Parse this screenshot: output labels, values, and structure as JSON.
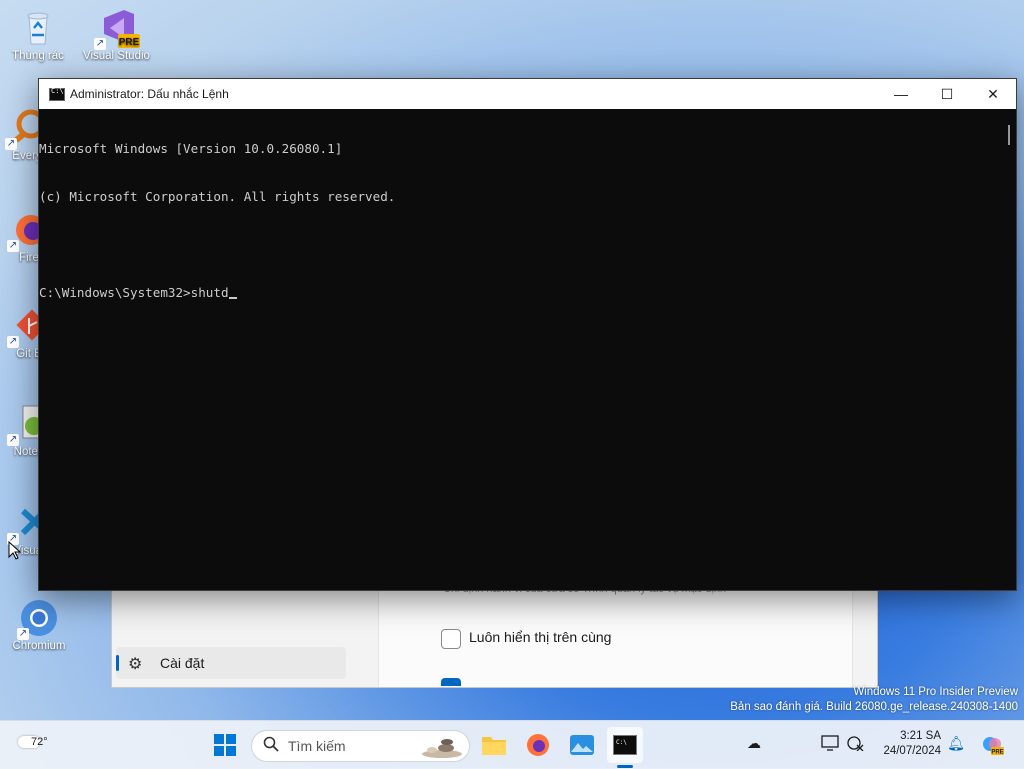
{
  "desktop": {
    "icons": [
      {
        "label": "Thùng rác",
        "icon": "recycle-bin-icon"
      },
      {
        "label": "Visual Studio",
        "icon": "visual-studio-icon",
        "badge": "PRE"
      },
      {
        "label": "Every",
        "icon": "everything-search-icon"
      },
      {
        "label": "Fire",
        "icon": "firefox-icon"
      },
      {
        "label": "Git B",
        "icon": "git-bash-icon"
      },
      {
        "label": "Notep",
        "icon": "notepad-plus-plus-icon"
      },
      {
        "label": "Visual",
        "icon": "vscode-icon"
      },
      {
        "label": "Chromium",
        "icon": "chromium-icon"
      }
    ]
  },
  "cmd": {
    "title": "Administrator: Dấu nhắc Lệnh",
    "lines": [
      "Microsoft Windows [Version 10.0.26080.1]",
      "(c) Microsoft Corporation. All rights reserved.",
      "",
      "C:\\Windows\\System32>shutd"
    ],
    "buttons": {
      "minimize": "—",
      "maximize": "☐",
      "close": "✕"
    }
  },
  "settings": {
    "hint": "Chỉ định hành vi của cửa sổ Trình quản lý tác vụ mặc định",
    "always_on_top": "Luôn hiển thị trên cùng",
    "nav_settings": "Cài đặt"
  },
  "watermark": {
    "line1": "Windows 11 Pro Insider Preview",
    "line2": "Bản sao đánh giá. Build 26080.ge_release.240308-1400"
  },
  "taskbar": {
    "weather_temp": "72°",
    "search_placeholder": "Tìm kiếm",
    "clock_time": "3:21 SA",
    "clock_date": "24/07/2024",
    "accent": "#0067c0"
  }
}
